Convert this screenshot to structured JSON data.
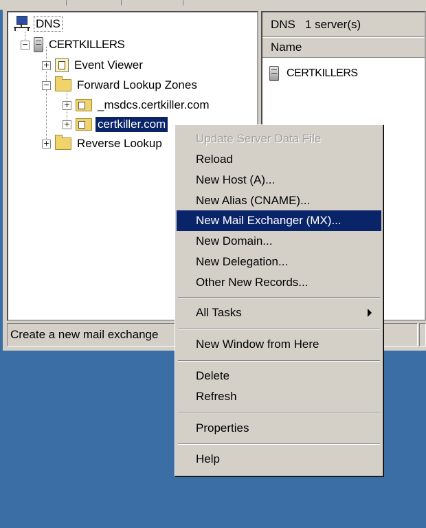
{
  "tree": {
    "root_label": "DNS",
    "server_label": "CERTKILLERS",
    "event_viewer_label": "Event Viewer",
    "forward_lookup_label": "Forward Lookup Zones",
    "msdcs_zone_label": "_msdcs.certkiller.com",
    "certkiller_zone_label": "certkiller.com",
    "reverse_lookup_label": "Reverse Lookup",
    "expander_plus": "+",
    "expander_minus": "−"
  },
  "right_pane": {
    "header_title": "DNS",
    "header_count": "1 server(s)",
    "column_name": "Name",
    "item_label": "CERTKILLERS"
  },
  "status_bar": {
    "text": "Create a new mail exchange"
  },
  "context_menu": {
    "items": [
      {
        "label": "Update Server Data File",
        "state": "disabled"
      },
      {
        "label": "Reload"
      },
      {
        "label": "New Host (A)..."
      },
      {
        "label": "New Alias (CNAME)..."
      },
      {
        "label": "New Mail Exchanger (MX)...",
        "state": "highlighted"
      },
      {
        "label": "New Domain..."
      },
      {
        "label": "New Delegation..."
      },
      {
        "label": "Other New Records..."
      },
      {
        "label": "All Tasks",
        "submenu": true
      },
      {
        "label": "New Window from Here"
      },
      {
        "label": "Delete"
      },
      {
        "label": "Refresh"
      },
      {
        "label": "Properties"
      },
      {
        "label": "Help"
      }
    ]
  },
  "colors": {
    "desktop": "#3a6ea5",
    "selection": "#0a246a",
    "face": "#d4d0c8"
  }
}
